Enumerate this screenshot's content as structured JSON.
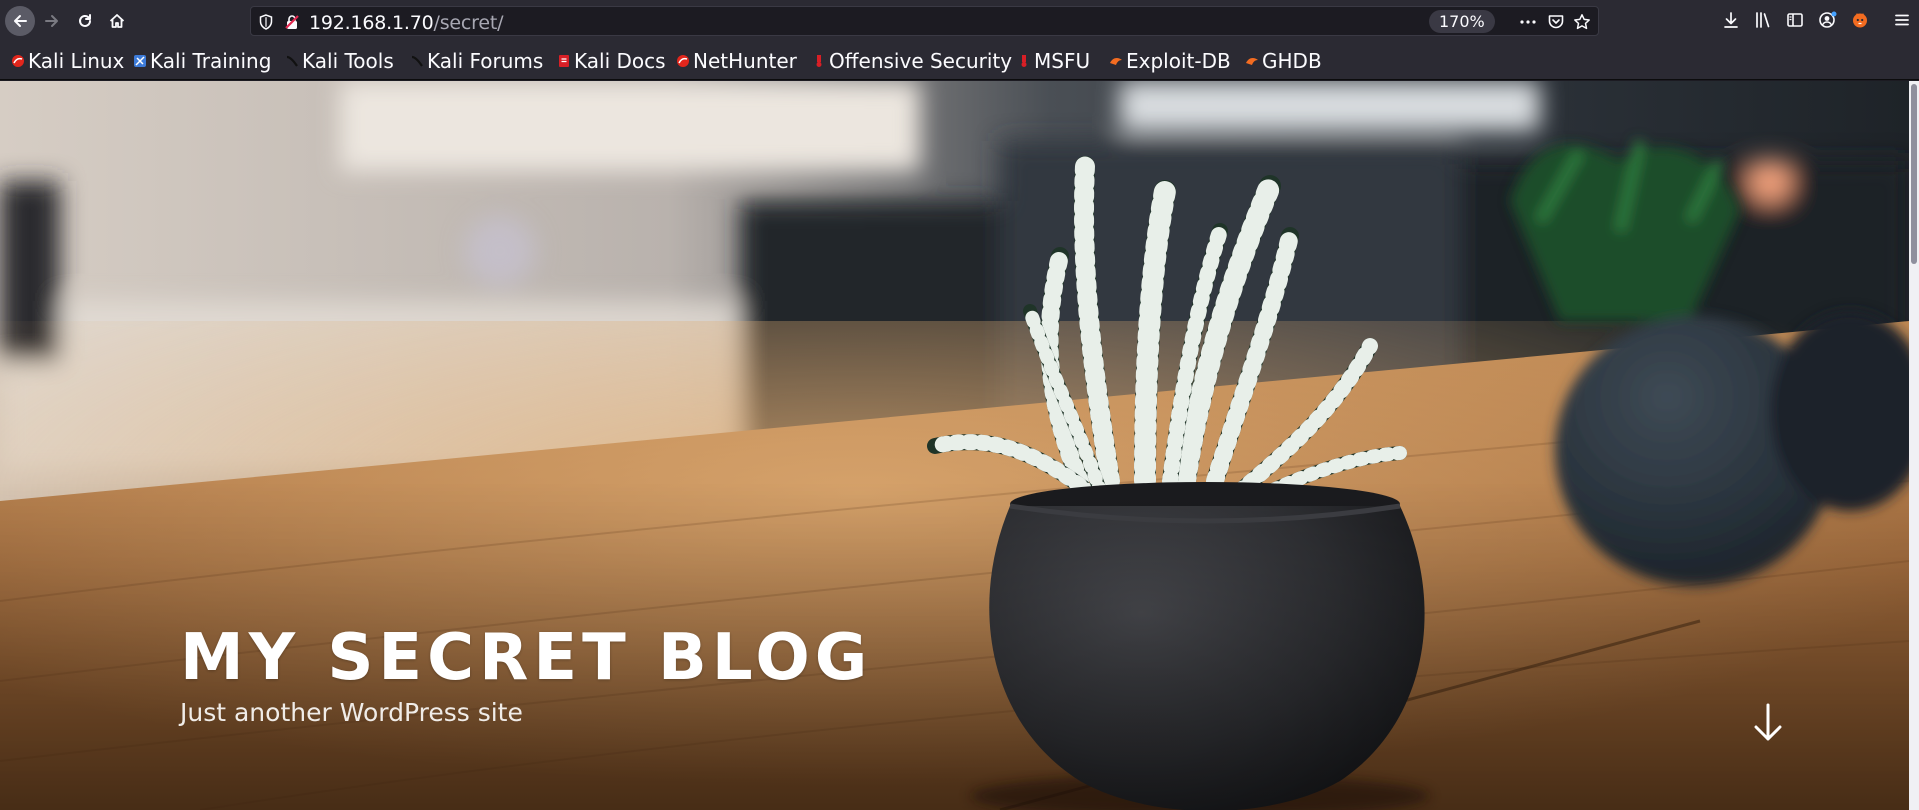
{
  "browser": {
    "url": {
      "host": "192.168.1.70",
      "path": "/secret/",
      "zoom": "170%"
    },
    "bookmarks": [
      {
        "label": "Kali Linux",
        "icon": "kali-dragon-icon"
      },
      {
        "label": "Kali Training",
        "icon": "kali-training-icon"
      },
      {
        "label": "Kali Tools",
        "icon": "kali-tools-icon"
      },
      {
        "label": "Kali Forums",
        "icon": "kali-forums-icon"
      },
      {
        "label": "Kali Docs",
        "icon": "kali-docs-icon"
      },
      {
        "label": "NetHunter",
        "icon": "nethunter-icon"
      },
      {
        "label": "Offensive Security",
        "icon": "offsec-icon"
      },
      {
        "label": "MSFU",
        "icon": "msfu-icon"
      },
      {
        "label": "Exploit-DB",
        "icon": "exploit-db-icon"
      },
      {
        "label": "GHDB",
        "icon": "ghdb-icon"
      }
    ]
  },
  "site": {
    "title": "MY SECRET BLOG",
    "description": "Just another WordPress site"
  },
  "colors": {
    "toolbar": "#2b2a33",
    "urlbar": "#1c1b22",
    "kali_red": "#e2261c",
    "exploit_orange": "#f36c21"
  }
}
